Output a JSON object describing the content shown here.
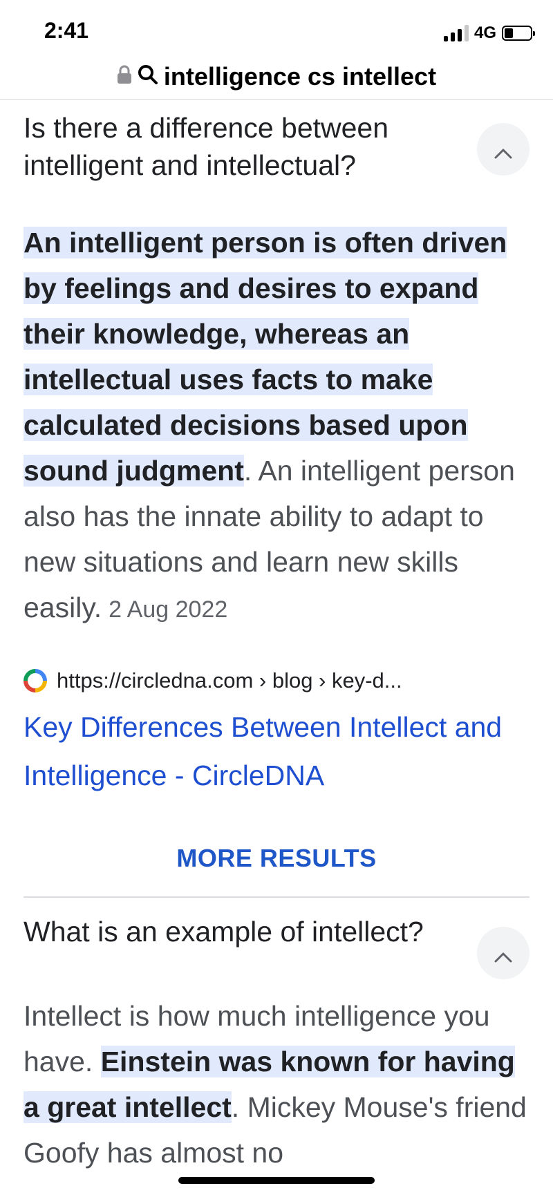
{
  "status_bar": {
    "time": "2:41",
    "network": "4G"
  },
  "url_bar": {
    "query": "intelligence cs intellect"
  },
  "faq": [
    {
      "question": "Is there a difference between intelligent and intellectual?",
      "answer_highlight": "An intelligent person is often driven by feelings and desires to expand their knowledge, whereas an intellectual uses facts to make calculated decisions based upon sound judgment",
      "answer_rest": ". An intelligent person also has the innate ability to adapt to new situations and learn new skills easily.",
      "date": "2 Aug 2022",
      "source_url": "https://circledna.com › blog › key-d...",
      "result_title": "Key Differences Between Intellect and Intelligence - CircleDNA"
    },
    {
      "question": "What is an example of intellect?",
      "answer_before": "Intellect is how much intelligence you have. ",
      "answer_highlight": "Einstein was known for having a great intellect",
      "answer_rest": ". Mickey Mouse's friend Goofy has almost no"
    }
  ],
  "more_results_label": "MORE RESULTS",
  "colors": {
    "highlight": "#e1e9fc",
    "link": "#1f4fd1",
    "more_results": "#1f57c8"
  }
}
